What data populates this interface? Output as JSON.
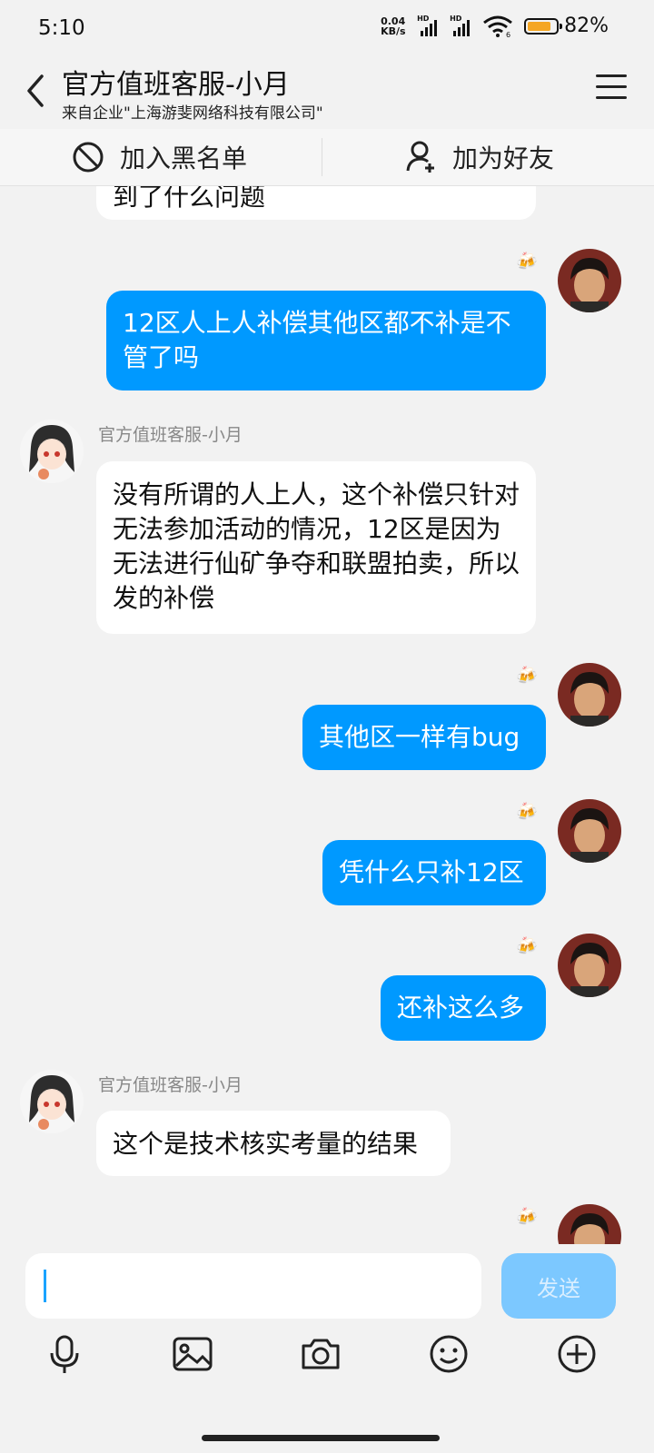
{
  "status": {
    "time": "5:10",
    "net_speed_value": "0.04",
    "net_speed_unit": "KB/s",
    "hd1": "HD",
    "hd2": "HD",
    "wifi_badge": "6",
    "battery_pct": "82%",
    "battery_level": 0.82
  },
  "header": {
    "title": "官方值班客服-小月",
    "subtitle": "来自企业\"上海游斐网络科技有限公司\""
  },
  "actions": {
    "block": "加入黑名单",
    "add_friend": "加为好友"
  },
  "messages": [
    {
      "from": "agent",
      "text": "到了什么问题"
    },
    {
      "from": "me",
      "badge": "🍻",
      "text": "12区人上人补偿其他区都不补是不管了吗"
    },
    {
      "from": "agent",
      "sender": "官方值班客服-小月",
      "text": "没有所谓的人上人，这个补偿只针对无法参加活动的情况，12区是因为无法进行仙矿争夺和联盟拍卖，所以发的补偿"
    },
    {
      "from": "me",
      "badge": "🍻",
      "text": "其他区一样有bug"
    },
    {
      "from": "me",
      "badge": "🍻",
      "text": "凭什么只补12区"
    },
    {
      "from": "me",
      "badge": "🍻",
      "text": "还补这么多"
    },
    {
      "from": "agent",
      "sender": "官方值班客服-小月",
      "text": "这个是技术核实考量的结果"
    },
    {
      "from": "me",
      "badge": "🍻",
      "text": ""
    }
  ],
  "composer": {
    "placeholder": "",
    "send_label": "发送"
  },
  "toolbar": [
    "mic-icon",
    "image-icon",
    "camera-icon",
    "emoji-icon",
    "plus-icon"
  ]
}
